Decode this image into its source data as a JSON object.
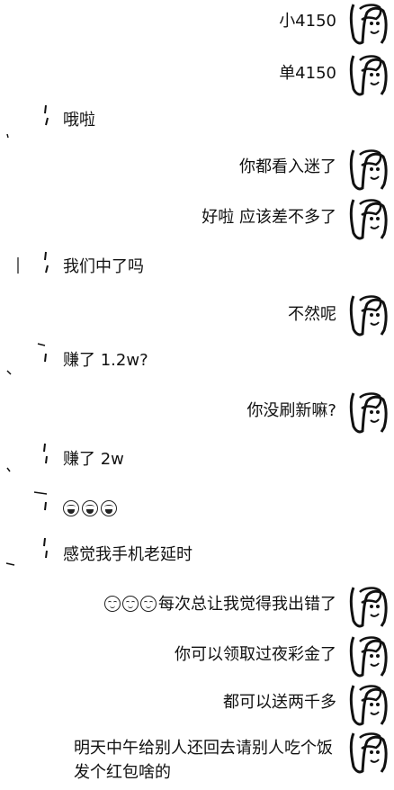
{
  "messages": [
    {
      "side": "right",
      "text": "小4150"
    },
    {
      "side": "right",
      "text": "单4150"
    },
    {
      "side": "left",
      "text": "哦啦"
    },
    {
      "side": "right",
      "text": "你都看入迷了"
    },
    {
      "side": "right",
      "text": "好啦 应该差不多了"
    },
    {
      "side": "left",
      "text": "我们中了吗"
    },
    {
      "side": "right",
      "text": "不然呢"
    },
    {
      "side": "left",
      "text": "赚了 1.2w?"
    },
    {
      "side": "right",
      "text": "你没刷新嘛?"
    },
    {
      "side": "left",
      "text": "赚了 2w"
    },
    {
      "side": "left",
      "emoji": "laugh-cry-face-icon x3"
    },
    {
      "side": "left",
      "text": "感觉我手机老延时"
    },
    {
      "side": "right",
      "emoji_prefix": "pensive-face-icon x3",
      "text": "每次总让我觉得我出错了"
    },
    {
      "side": "right",
      "text": "你可以领取过夜彩金了"
    },
    {
      "side": "right",
      "text": "都可以送两千多"
    },
    {
      "side": "right",
      "text": "明天中午给别人还回去请别人吃个饭发个红包啥的"
    }
  ]
}
